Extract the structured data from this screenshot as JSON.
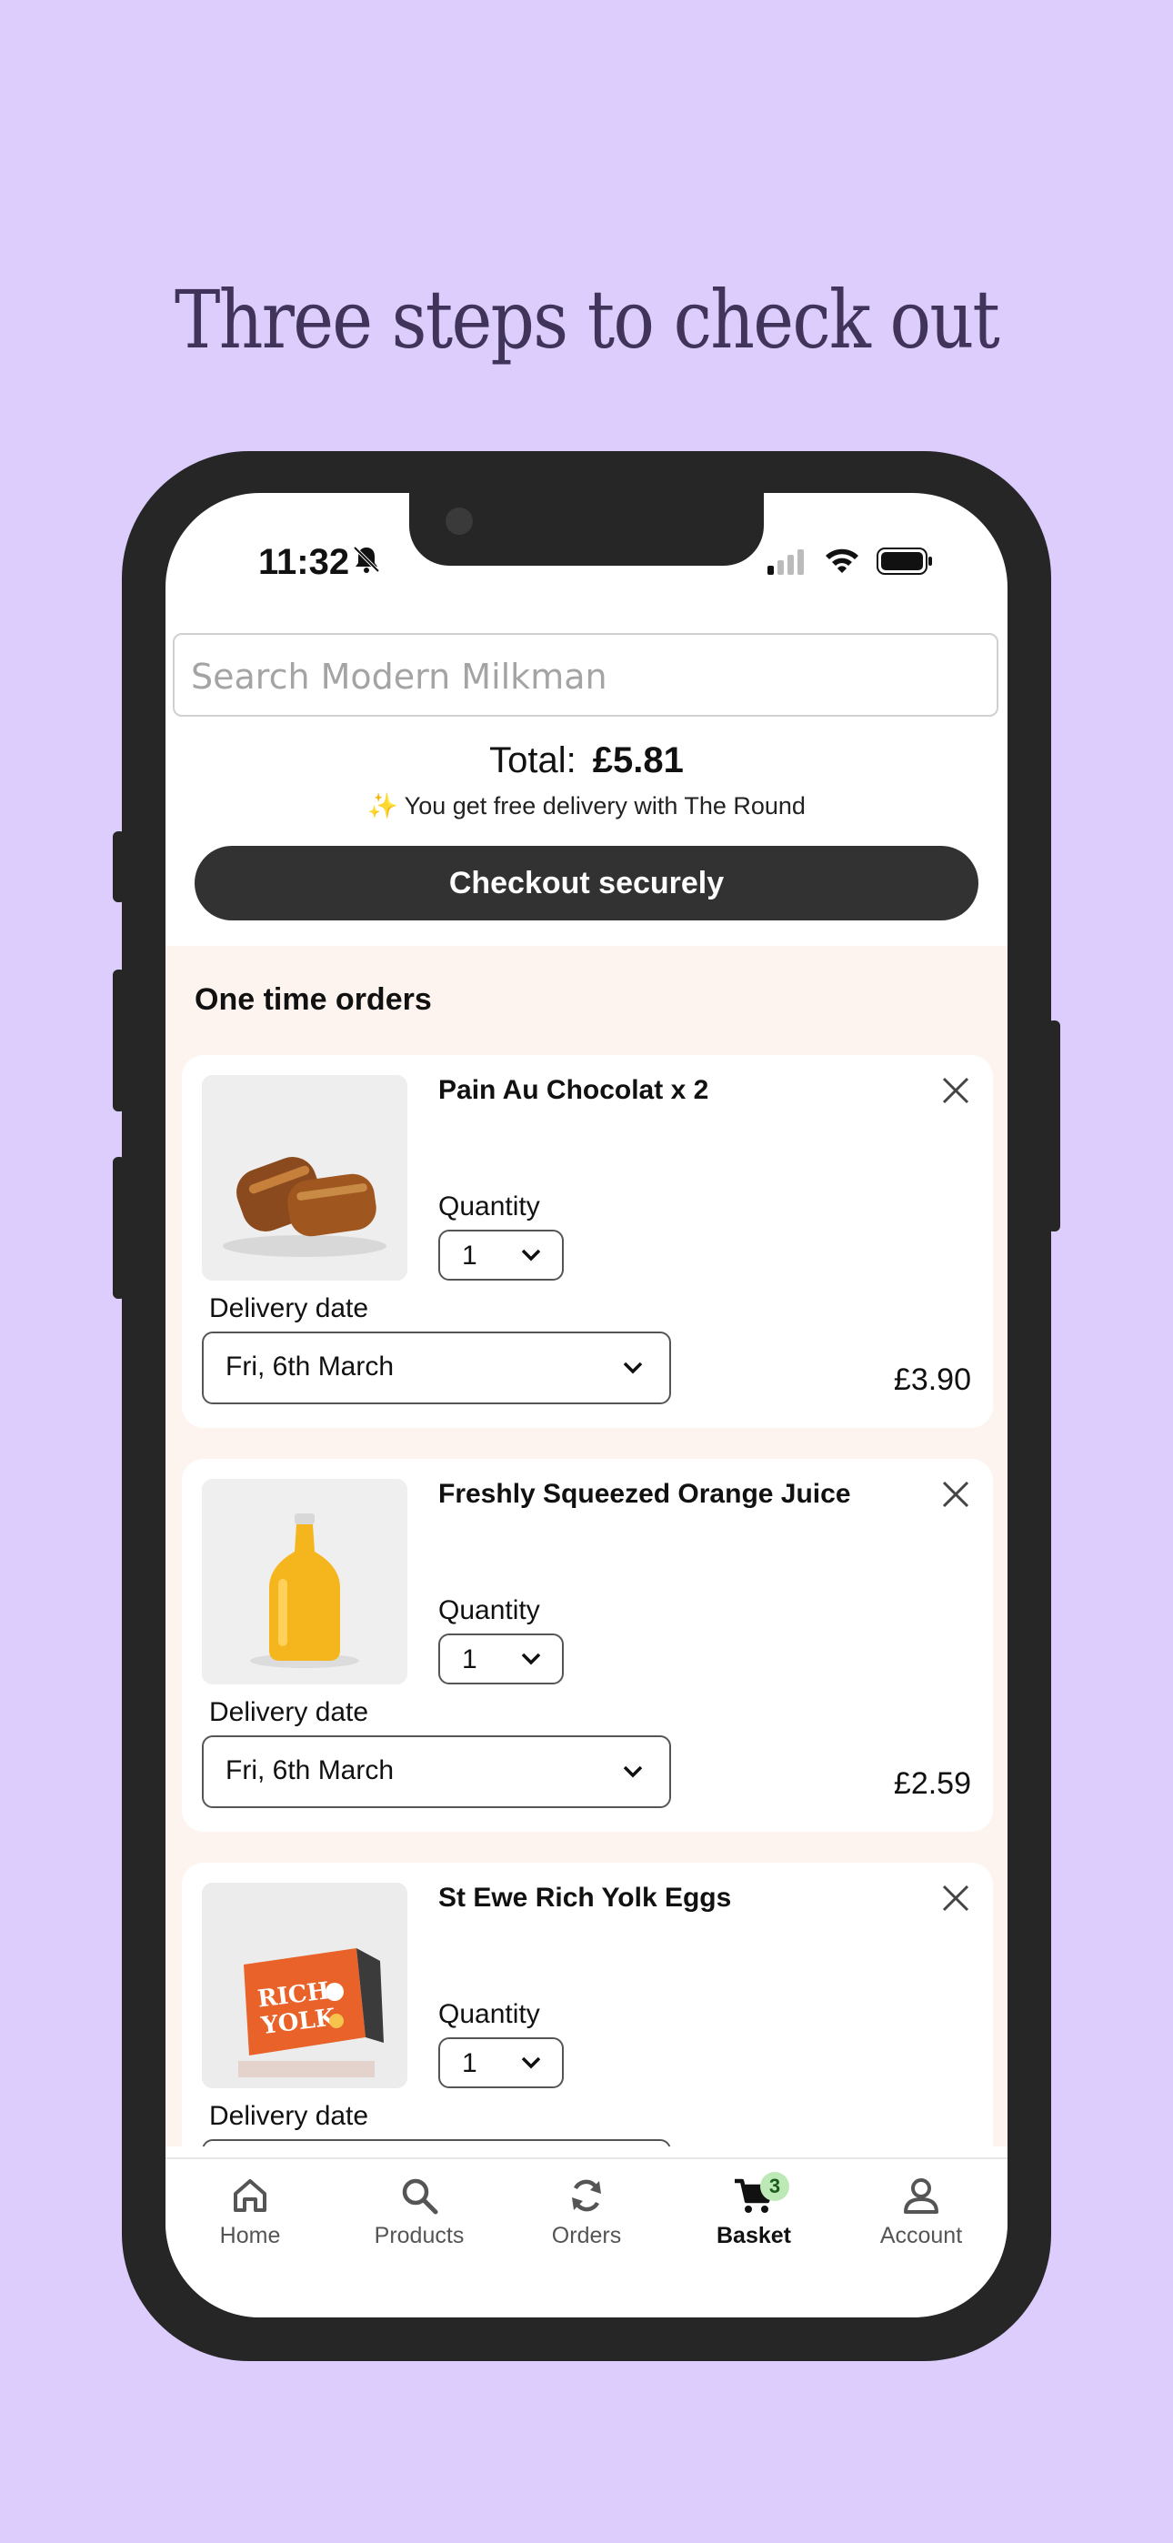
{
  "headline": "Three steps to check out",
  "status_bar": {
    "time": "11:32"
  },
  "search": {
    "placeholder": "Search Modern Milkman"
  },
  "summary": {
    "total_label": "Total:",
    "total_value": "£5.81",
    "promo_emoji": "✨",
    "promo_text": "You get free delivery with The Round",
    "checkout_label": "Checkout securely"
  },
  "orders": {
    "section_title": "One time orders",
    "quantity_label": "Quantity",
    "delivery_label": "Delivery date",
    "items": [
      {
        "name": "Pain Au Chocolat x 2",
        "quantity": "1",
        "delivery_date": "Fri, 6th March",
        "price": "£3.90"
      },
      {
        "name": "Freshly Squeezed Orange Juice",
        "quantity": "1",
        "delivery_date": "Fri, 6th March",
        "price": "£2.59"
      },
      {
        "name": "St Ewe Rich Yolk Eggs",
        "quantity": "1",
        "delivery_date": "",
        "price": ""
      }
    ]
  },
  "tabbar": {
    "tabs": [
      {
        "label": "Home",
        "icon": "home-icon",
        "active": false
      },
      {
        "label": "Products",
        "icon": "search-icon",
        "active": false
      },
      {
        "label": "Orders",
        "icon": "refresh-icon",
        "active": false
      },
      {
        "label": "Basket",
        "icon": "cart-icon",
        "active": true,
        "badge": "3"
      },
      {
        "label": "Account",
        "icon": "person-icon",
        "active": false
      }
    ]
  },
  "colors": {
    "background": "#dccdfd",
    "headline": "#40345a",
    "checkout_button": "#323232",
    "content_bg": "#fef4ef",
    "badge": "#bde9b6"
  }
}
